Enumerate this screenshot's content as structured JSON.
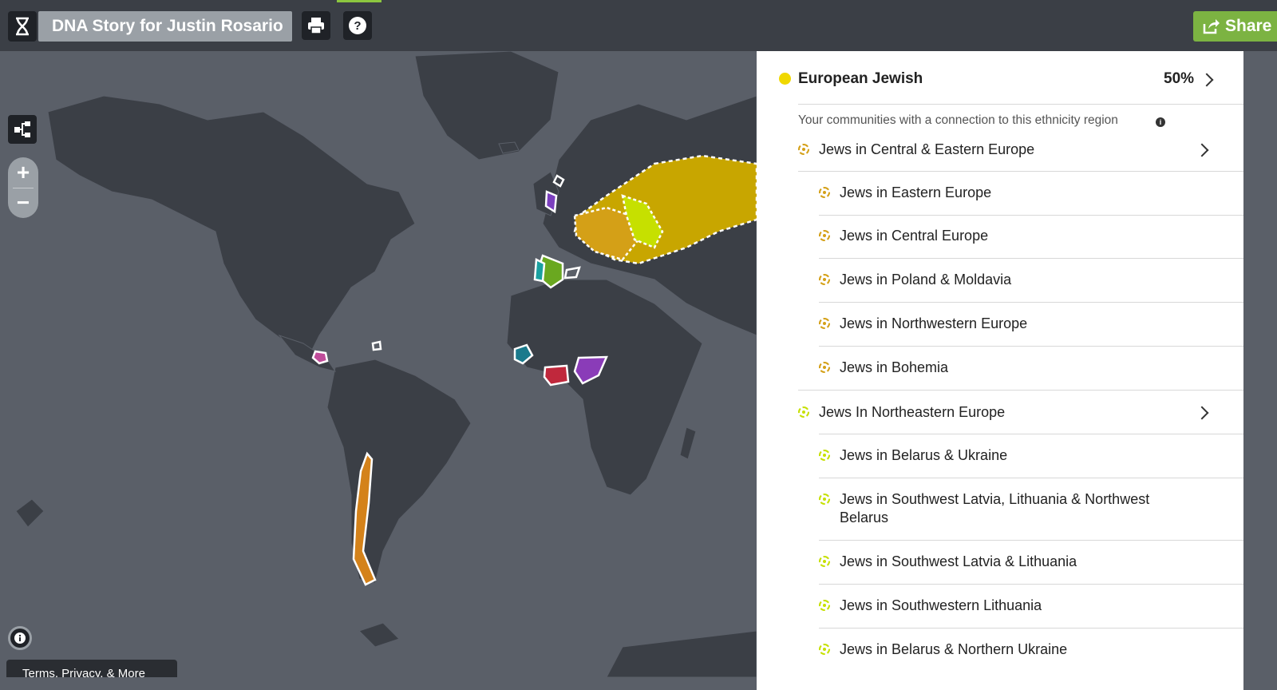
{
  "header": {
    "title": "DNA Story for Justin Rosario",
    "share_label": "Share",
    "icons": [
      "dna-icon",
      "print-icon",
      "help-icon",
      "share-icon"
    ]
  },
  "map": {
    "controls": {
      "zoom_in": "+",
      "zoom_out": "−"
    },
    "footer_link": "Terms, Privacy, & More",
    "icons": [
      "tree-view-icon",
      "info-icon"
    ]
  },
  "panel": {
    "region": "European Jewish",
    "percent": "50%",
    "region_color": "#f0d800",
    "subtitle": "Your communities with a connection to this ethnicity region",
    "groups": [
      {
        "label": "Jews in Central & Eastern Europe",
        "color": "#d4a017",
        "children": [
          "Jews in Eastern Europe",
          "Jews in Central Europe",
          "Jews in Poland & Moldavia",
          "Jews in Northwestern Europe",
          "Jews in Bohemia"
        ]
      },
      {
        "label": "Jews In Northeastern Europe",
        "color": "#c6e000",
        "children": [
          "Jews in Belarus & Ukraine",
          "Jews in Southwest Latvia, Lithuania & Northwest Belarus",
          "Jews in Southwest Latvia & Lithuania",
          "Jews in Southwestern Lithuania",
          "Jews in Belarus & Northern Ukraine"
        ]
      }
    ]
  }
}
